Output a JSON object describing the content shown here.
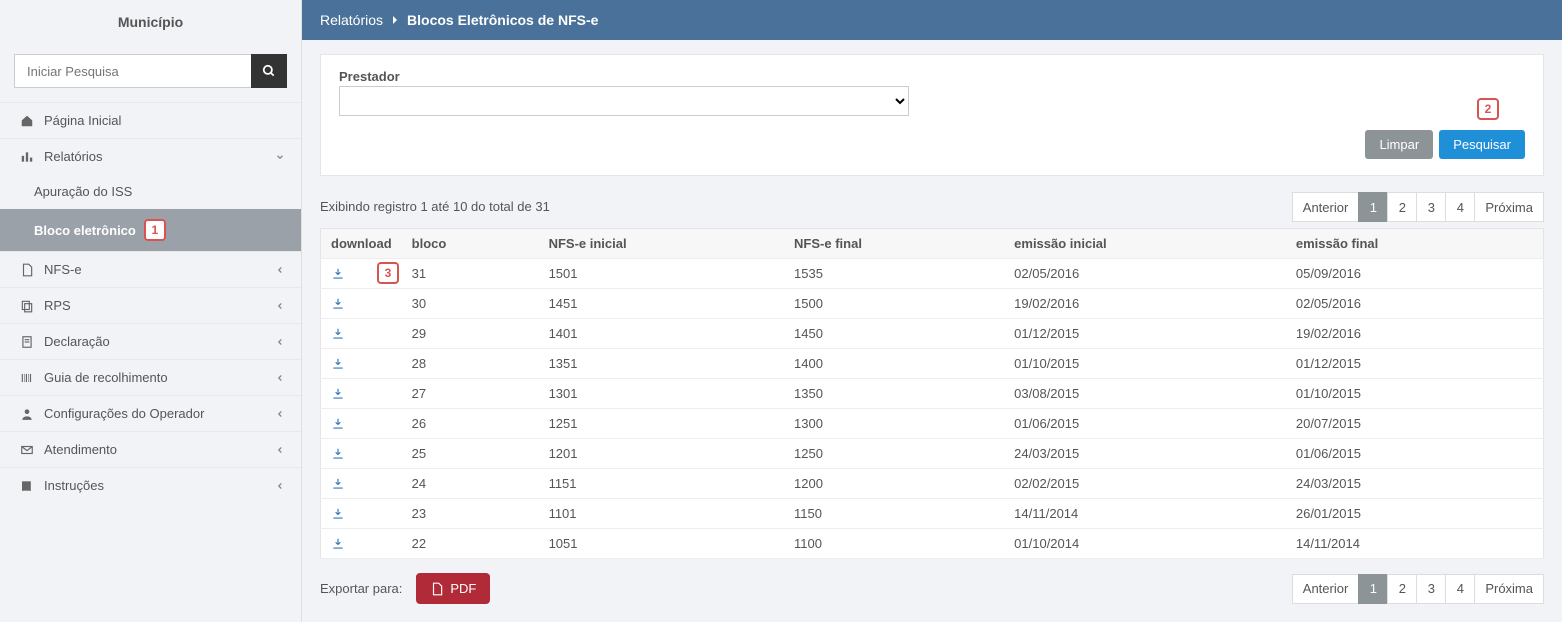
{
  "sidebar": {
    "title": "Município",
    "search_placeholder": "Iniciar Pesquisa",
    "items": {
      "home": "Página Inicial",
      "reports": "Relatórios",
      "reports_sub": {
        "apuracao": "Apuração do ISS",
        "bloco": "Bloco eletrônico"
      },
      "nfse": "NFS-e",
      "rps": "RPS",
      "declaracao": "Declaração",
      "guia": "Guia de recolhimento",
      "config": "Configurações do Operador",
      "atendimento": "Atendimento",
      "instrucoes": "Instruções"
    }
  },
  "callouts": {
    "c1": "1",
    "c2": "2",
    "c3": "3"
  },
  "header": {
    "crumb1": "Relatórios",
    "crumb2": "Blocos Eletrônicos de NFS-e"
  },
  "filter": {
    "label": "Prestador",
    "btn_clear": "Limpar",
    "btn_search": "Pesquisar"
  },
  "results": {
    "info": "Exibindo registro 1 até 10 do total de 31",
    "columns": {
      "download": "download",
      "bloco": "bloco",
      "nfse_ini": "NFS-e inicial",
      "nfse_fim": "NFS-e final",
      "em_ini": "emissão inicial",
      "em_fim": "emissão final"
    },
    "rows": [
      {
        "bloco": "31",
        "ini": "1501",
        "fim": "1535",
        "eini": "02/05/2016",
        "efim": "05/09/2016"
      },
      {
        "bloco": "30",
        "ini": "1451",
        "fim": "1500",
        "eini": "19/02/2016",
        "efim": "02/05/2016"
      },
      {
        "bloco": "29",
        "ini": "1401",
        "fim": "1450",
        "eini": "01/12/2015",
        "efim": "19/02/2016"
      },
      {
        "bloco": "28",
        "ini": "1351",
        "fim": "1400",
        "eini": "01/10/2015",
        "efim": "01/12/2015"
      },
      {
        "bloco": "27",
        "ini": "1301",
        "fim": "1350",
        "eini": "03/08/2015",
        "efim": "01/10/2015"
      },
      {
        "bloco": "26",
        "ini": "1251",
        "fim": "1300",
        "eini": "01/06/2015",
        "efim": "20/07/2015"
      },
      {
        "bloco": "25",
        "ini": "1201",
        "fim": "1250",
        "eini": "24/03/2015",
        "efim": "01/06/2015"
      },
      {
        "bloco": "24",
        "ini": "1151",
        "fim": "1200",
        "eini": "02/02/2015",
        "efim": "24/03/2015"
      },
      {
        "bloco": "23",
        "ini": "1101",
        "fim": "1150",
        "eini": "14/11/2014",
        "efim": "26/01/2015"
      },
      {
        "bloco": "22",
        "ini": "1051",
        "fim": "1100",
        "eini": "01/10/2014",
        "efim": "14/11/2014"
      }
    ]
  },
  "pager": {
    "prev": "Anterior",
    "p1": "1",
    "p2": "2",
    "p3": "3",
    "p4": "4",
    "next": "Próxima"
  },
  "export": {
    "label": "Exportar para:",
    "pdf": "PDF"
  }
}
